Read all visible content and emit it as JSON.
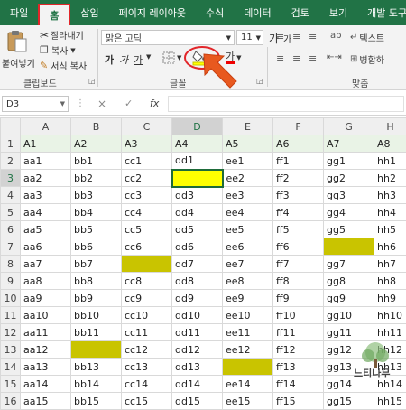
{
  "tabs": [
    "파일",
    "홈",
    "삽입",
    "페이지 레이아웃",
    "수식",
    "데이터",
    "검토",
    "보기",
    "개발 도구"
  ],
  "clipboard": {
    "paste": "붙여넣기",
    "cut": "잘라내기",
    "copy": "복사",
    "format_painter": "서식 복사",
    "label": "클립보드"
  },
  "font": {
    "name": "맑은 고딕",
    "size": "11",
    "bold": "가",
    "italic": "가",
    "underline": "가",
    "grow": "가",
    "shrink": "가",
    "label": "글꼴",
    "fill_color": "#ffff00"
  },
  "alignment": {
    "text_wrap": "텍스트",
    "merge": "병합하",
    "label": "맞춤"
  },
  "formula_bar": {
    "name_box": "D3",
    "cancel": "×",
    "enter": "✓",
    "fx": "fx",
    "value": ""
  },
  "columns": [
    "A",
    "B",
    "C",
    "D",
    "E",
    "F",
    "G",
    "H"
  ],
  "rows": [
    [
      "1",
      "A1",
      "A2",
      "A3",
      "A4",
      "A5",
      "A6",
      "A7",
      "A8"
    ],
    [
      "2",
      "aa1",
      "bb1",
      "cc1",
      "dd1",
      "ee1",
      "ff1",
      "gg1",
      "hh1"
    ],
    [
      "3",
      "aa2",
      "bb2",
      "cc2",
      "",
      "ee2",
      "ff2",
      "gg2",
      "hh2"
    ],
    [
      "4",
      "aa3",
      "bb3",
      "cc3",
      "dd3",
      "ee3",
      "ff3",
      "gg3",
      "hh3"
    ],
    [
      "5",
      "aa4",
      "bb4",
      "cc4",
      "dd4",
      "ee4",
      "ff4",
      "gg4",
      "hh4"
    ],
    [
      "6",
      "aa5",
      "bb5",
      "cc5",
      "dd5",
      "ee5",
      "ff5",
      "gg5",
      "hh5"
    ],
    [
      "7",
      "aa6",
      "bb6",
      "cc6",
      "dd6",
      "ee6",
      "ff6",
      "",
      "hh6"
    ],
    [
      "8",
      "aa7",
      "bb7",
      "",
      "dd7",
      "ee7",
      "ff7",
      "gg7",
      "hh7"
    ],
    [
      "9",
      "aa8",
      "bb8",
      "cc8",
      "dd8",
      "ee8",
      "ff8",
      "gg8",
      "hh8"
    ],
    [
      "10",
      "aa9",
      "bb9",
      "cc9",
      "dd9",
      "ee9",
      "ff9",
      "gg9",
      "hh9"
    ],
    [
      "11",
      "aa10",
      "bb10",
      "cc10",
      "dd10",
      "ee10",
      "ff10",
      "gg10",
      "hh10"
    ],
    [
      "12",
      "aa11",
      "bb11",
      "cc11",
      "dd11",
      "ee11",
      "ff11",
      "gg11",
      "hh11"
    ],
    [
      "13",
      "aa12",
      "",
      "cc12",
      "dd12",
      "ee12",
      "ff12",
      "gg12",
      "hh12"
    ],
    [
      "14",
      "aa13",
      "bb13",
      "cc13",
      "dd13",
      "",
      "ff13",
      "gg13",
      "hh13"
    ],
    [
      "15",
      "aa14",
      "bb14",
      "cc14",
      "dd14",
      "ee14",
      "ff14",
      "gg14",
      "hh14"
    ],
    [
      "16",
      "aa15",
      "bb15",
      "cc15",
      "dd15",
      "ee15",
      "ff15",
      "gg15",
      "hh15"
    ]
  ],
  "highlights": {
    "selected_cell": "D3",
    "selected_fill": "#ffff00",
    "olive_fill": "#c9c400",
    "olive_cells": [
      "C8",
      "G7",
      "B13",
      "E14"
    ]
  },
  "watermark": "느티나무"
}
